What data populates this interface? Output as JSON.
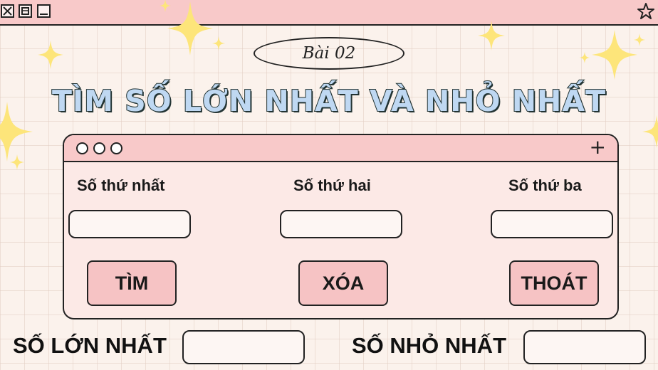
{
  "titlebar": {
    "close_icon": "close-icon",
    "maximize_icon": "maximize-icon",
    "minimize_icon": "minimize-icon",
    "favorite_icon": "star-icon"
  },
  "lesson": "Bài 02",
  "title": "TÌM SỐ LỚN NHẤT VÀ NHỎ NHẤT",
  "form": {
    "fields": [
      {
        "label": "Số thứ nhất",
        "value": ""
      },
      {
        "label": "Số thứ hai",
        "value": ""
      },
      {
        "label": "Số thứ ba",
        "value": ""
      }
    ],
    "buttons": {
      "find": "TÌM",
      "clear": "XÓA",
      "exit": "THOÁT"
    },
    "window_controls_icon": "traffic-dots-icon",
    "add_icon": "plus-icon"
  },
  "results": {
    "max_label": "SỐ LỚN NHẤT",
    "max_value": "",
    "min_label": "SỐ NHỎ NHẤT",
    "min_value": ""
  },
  "colors": {
    "background": "#fbf2ec",
    "bar_pink": "#f8c9c9",
    "button_pink": "#f6c3c4",
    "title_blue": "#bfd8f2",
    "sparkle_yellow": "#fde57a"
  }
}
